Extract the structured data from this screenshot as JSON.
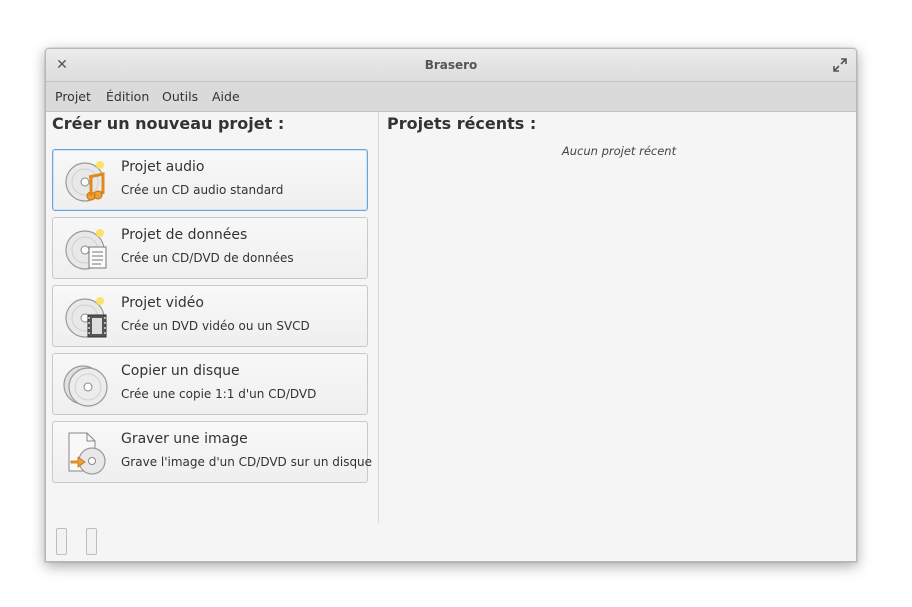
{
  "window": {
    "title": "Brasero"
  },
  "menu": [
    "Projet",
    "Édition",
    "Outils",
    "Aide"
  ],
  "left": {
    "heading": "Créer un nouveau projet :",
    "projects": [
      {
        "title": "Projet audio",
        "subtitle": "Crée un CD audio standard",
        "icon": "audio-disc-icon"
      },
      {
        "title": "Projet de données",
        "subtitle": "Crée un CD/DVD de données",
        "icon": "data-disc-icon"
      },
      {
        "title": "Projet vidéo",
        "subtitle": "Crée un DVD vidéo ou un SVCD",
        "icon": "video-disc-icon"
      },
      {
        "title": "Copier un disque",
        "subtitle": "Crée une copie 1:1 d'un CD/DVD",
        "icon": "copy-disc-icon"
      },
      {
        "title": "Graver une image",
        "subtitle": "Grave l'image d'un CD/DVD sur un disque",
        "icon": "burn-image-icon"
      }
    ]
  },
  "right": {
    "heading": "Projets récents :",
    "empty_message": "Aucun projet récent"
  },
  "colors": {
    "focus_border": "#6aa4d8",
    "window_bg": "#f5f5f5",
    "menubar_bg": "#dadada"
  }
}
